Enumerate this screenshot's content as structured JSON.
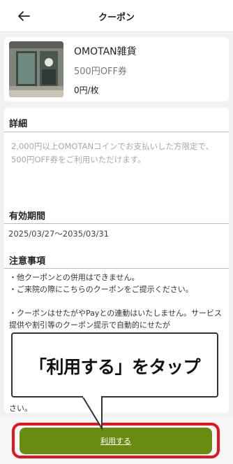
{
  "header": {
    "title": "クーポン",
    "back_icon": "arrow-left-icon"
  },
  "coupon": {
    "shop_name": "OMOTAN雑貨",
    "title": "500円OFF券",
    "price": "0円/枚"
  },
  "details": {
    "heading": "詳細",
    "description": "2,000円以上OMOTANコインでお支払いした方限定で、500円OFF券をご利用いただけます。"
  },
  "validity": {
    "heading": "有効期間",
    "period": "2025/03/27～2035/03/31"
  },
  "notes": {
    "heading": "注意事項",
    "lines": [
      "・他クーポンとの併用はできません。",
      "・ご来院の際にこちらのクーポンをご提示ください。",
      "",
      "・クーポンはせたがやPayとの連動はいたしません。サービス提供や割引等のクーポン提示で自動的にせたが",
      "",
      "",
      "",
      "さい。"
    ]
  },
  "action": {
    "use_label": "利用する"
  },
  "callout": {
    "text": "「利用する」をタップ"
  },
  "colors": {
    "accent_green": "#6a8b12",
    "highlight_red": "#e8131c"
  }
}
